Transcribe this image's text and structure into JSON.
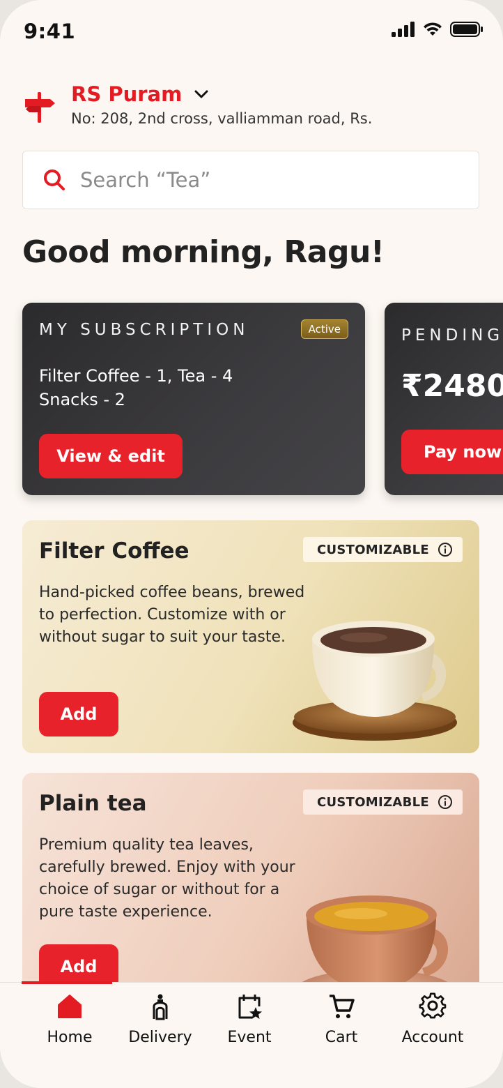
{
  "status_bar": {
    "time": "9:41"
  },
  "location": {
    "city": "RS Puram",
    "address": "No: 208, 2nd cross, valliamman road, Rs."
  },
  "search": {
    "placeholder": "Search “Tea”"
  },
  "greeting": "Good morning, Ragu!",
  "subscription_card": {
    "label": "MY SUBSCRIPTION",
    "badge": "Active",
    "items_line1": "Filter Coffee - 1, Tea - 4",
    "items_line2": "Snacks - 2",
    "button": "View & edit"
  },
  "pending_card": {
    "label": "PENDING",
    "amount": "₹2480",
    "button": "Pay now"
  },
  "products": [
    {
      "title": "Filter Coffee",
      "badge": "CUSTOMIZABLE",
      "description": "Hand-picked coffee beans, brewed to perfection. Customize with or without sugar to suit your taste.",
      "button": "Add"
    },
    {
      "title": "Plain tea",
      "badge": "CUSTOMIZABLE",
      "description": "Premium quality tea leaves, carefully brewed. Enjoy with your choice of sugar or without for a pure taste experience.",
      "button": "Add"
    }
  ],
  "bottom_nav": [
    {
      "label": "Home",
      "icon": "home-icon",
      "active": true
    },
    {
      "label": "Delivery",
      "icon": "delivery-icon",
      "active": false
    },
    {
      "label": "Event",
      "icon": "event-icon",
      "active": false
    },
    {
      "label": "Cart",
      "icon": "cart-icon",
      "active": false
    },
    {
      "label": "Account",
      "icon": "gear-icon",
      "active": false
    }
  ],
  "colors": {
    "brand_red": "#e31b23",
    "dark_card": "#333235",
    "background": "#fcf7f2",
    "active_badge": "#8a6b22"
  }
}
